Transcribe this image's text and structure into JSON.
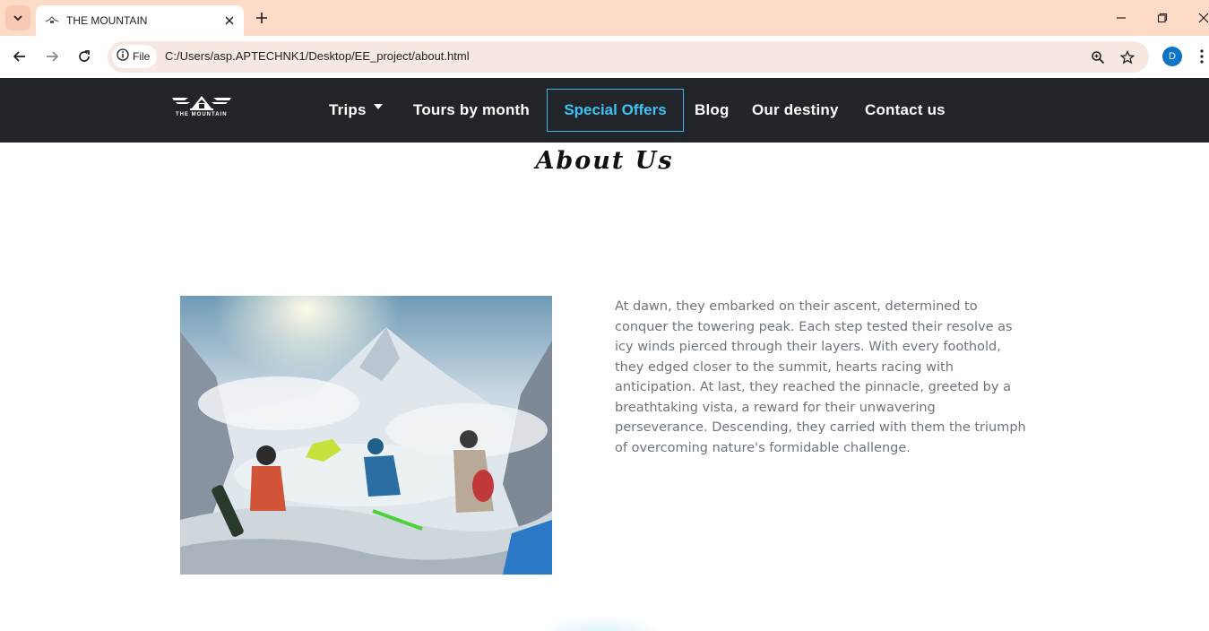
{
  "browser": {
    "tab_title": "THE MOUNTAIN",
    "file_chip": "File",
    "url": "C:/Users/asp.APTECHNK1/Desktop/EE_project/about.html",
    "profile_initial": "D"
  },
  "site": {
    "logo_text": "THE MOUNTAIN",
    "nav": {
      "trips": "Trips",
      "tours": "Tours by month",
      "special": "Special Offers",
      "blog": "Blog",
      "destiny": "Our destiny",
      "contact": "Contact us"
    },
    "page_title": "About Us",
    "about_paragraph": "At dawn, they embarked on their ascent, determined to conquer the towering peak. Each step tested their resolve as icy winds pierced through their layers. With every foothold, they edged closer to the summit, hearts racing with anticipation. At last, they reached the pinnacle, greeted by a breathtaking vista, a reward for their unwavering perseverance. Descending, they carried with them the triumph of overcoming nature's formidable challenge."
  },
  "colors": {
    "tabbar": "#fddbc7",
    "nav_bg": "#212529",
    "accent": "#3fc3f5",
    "text_muted": "#6c757d"
  },
  "icons": [
    "tab-list-icon",
    "favicon-icon",
    "close-icon",
    "plus-icon",
    "minimize-icon",
    "restore-icon",
    "close-window-icon",
    "back-arrow-icon",
    "forward-arrow-icon",
    "reload-icon",
    "info-icon",
    "zoom-icon",
    "star-icon",
    "menu-dots-icon",
    "caret-down-icon"
  ]
}
